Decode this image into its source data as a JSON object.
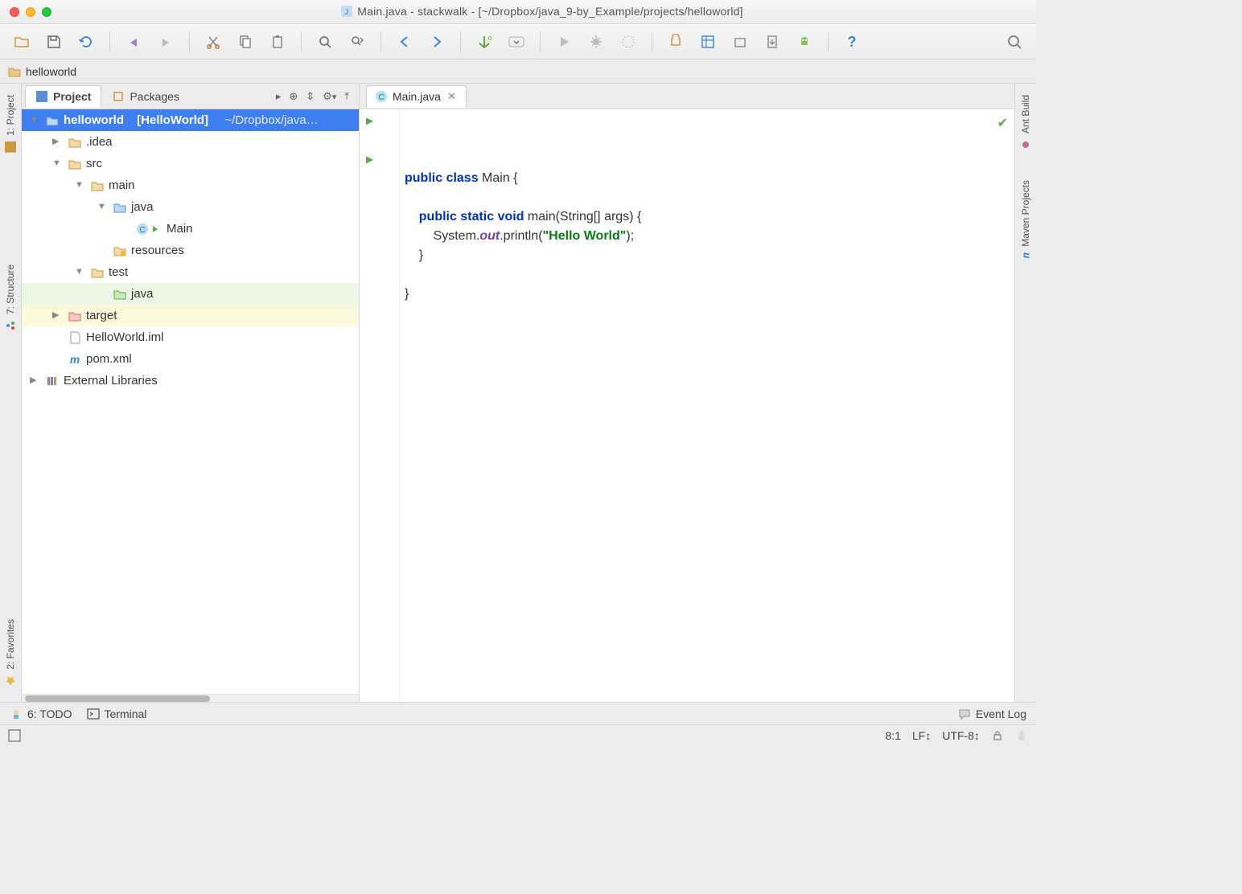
{
  "window": {
    "title": "Main.java - stackwalk - [~/Dropbox/java_9-by_Example/projects/helloworld]"
  },
  "breadcrumb": {
    "items": [
      "helloworld"
    ]
  },
  "left_rail": {
    "project": "1: Project",
    "structure": "7: Structure",
    "favorites": "2: Favorites"
  },
  "right_rail": {
    "ant": "Ant Build",
    "maven": "Maven Projects"
  },
  "project_panel": {
    "tabs": {
      "project": "Project",
      "packages": "Packages"
    },
    "tree": {
      "root": {
        "name": "helloworld",
        "module": "[HelloWorld]",
        "path": "~/Dropbox/java…"
      },
      "idea": ".idea",
      "src": "src",
      "main": "main",
      "java": "java",
      "main_class": "Main",
      "resources": "resources",
      "test": "test",
      "test_java": "java",
      "target": "target",
      "iml": "HelloWorld.iml",
      "pom": "pom.xml",
      "ext_lib": "External Libraries"
    }
  },
  "editor": {
    "tab": "Main.java",
    "code": {
      "l1a": "public",
      "l1b": "class",
      "l1c": " Main {",
      "l3a": "public",
      "l3b": "static",
      "l3c": "void",
      "l3d": " main(String[] args) {",
      "l4a": "        System.",
      "l4b": "out",
      "l4c": ".println(",
      "l4d": "\"Hello World\"",
      "l4e": ");",
      "l5": "    }",
      "l7": "}"
    }
  },
  "bottom": {
    "todo": "6: TODO",
    "terminal": "Terminal",
    "eventlog": "Event Log"
  },
  "status": {
    "pos": "8:1",
    "sep": "LF",
    "enc": "UTF-8"
  }
}
